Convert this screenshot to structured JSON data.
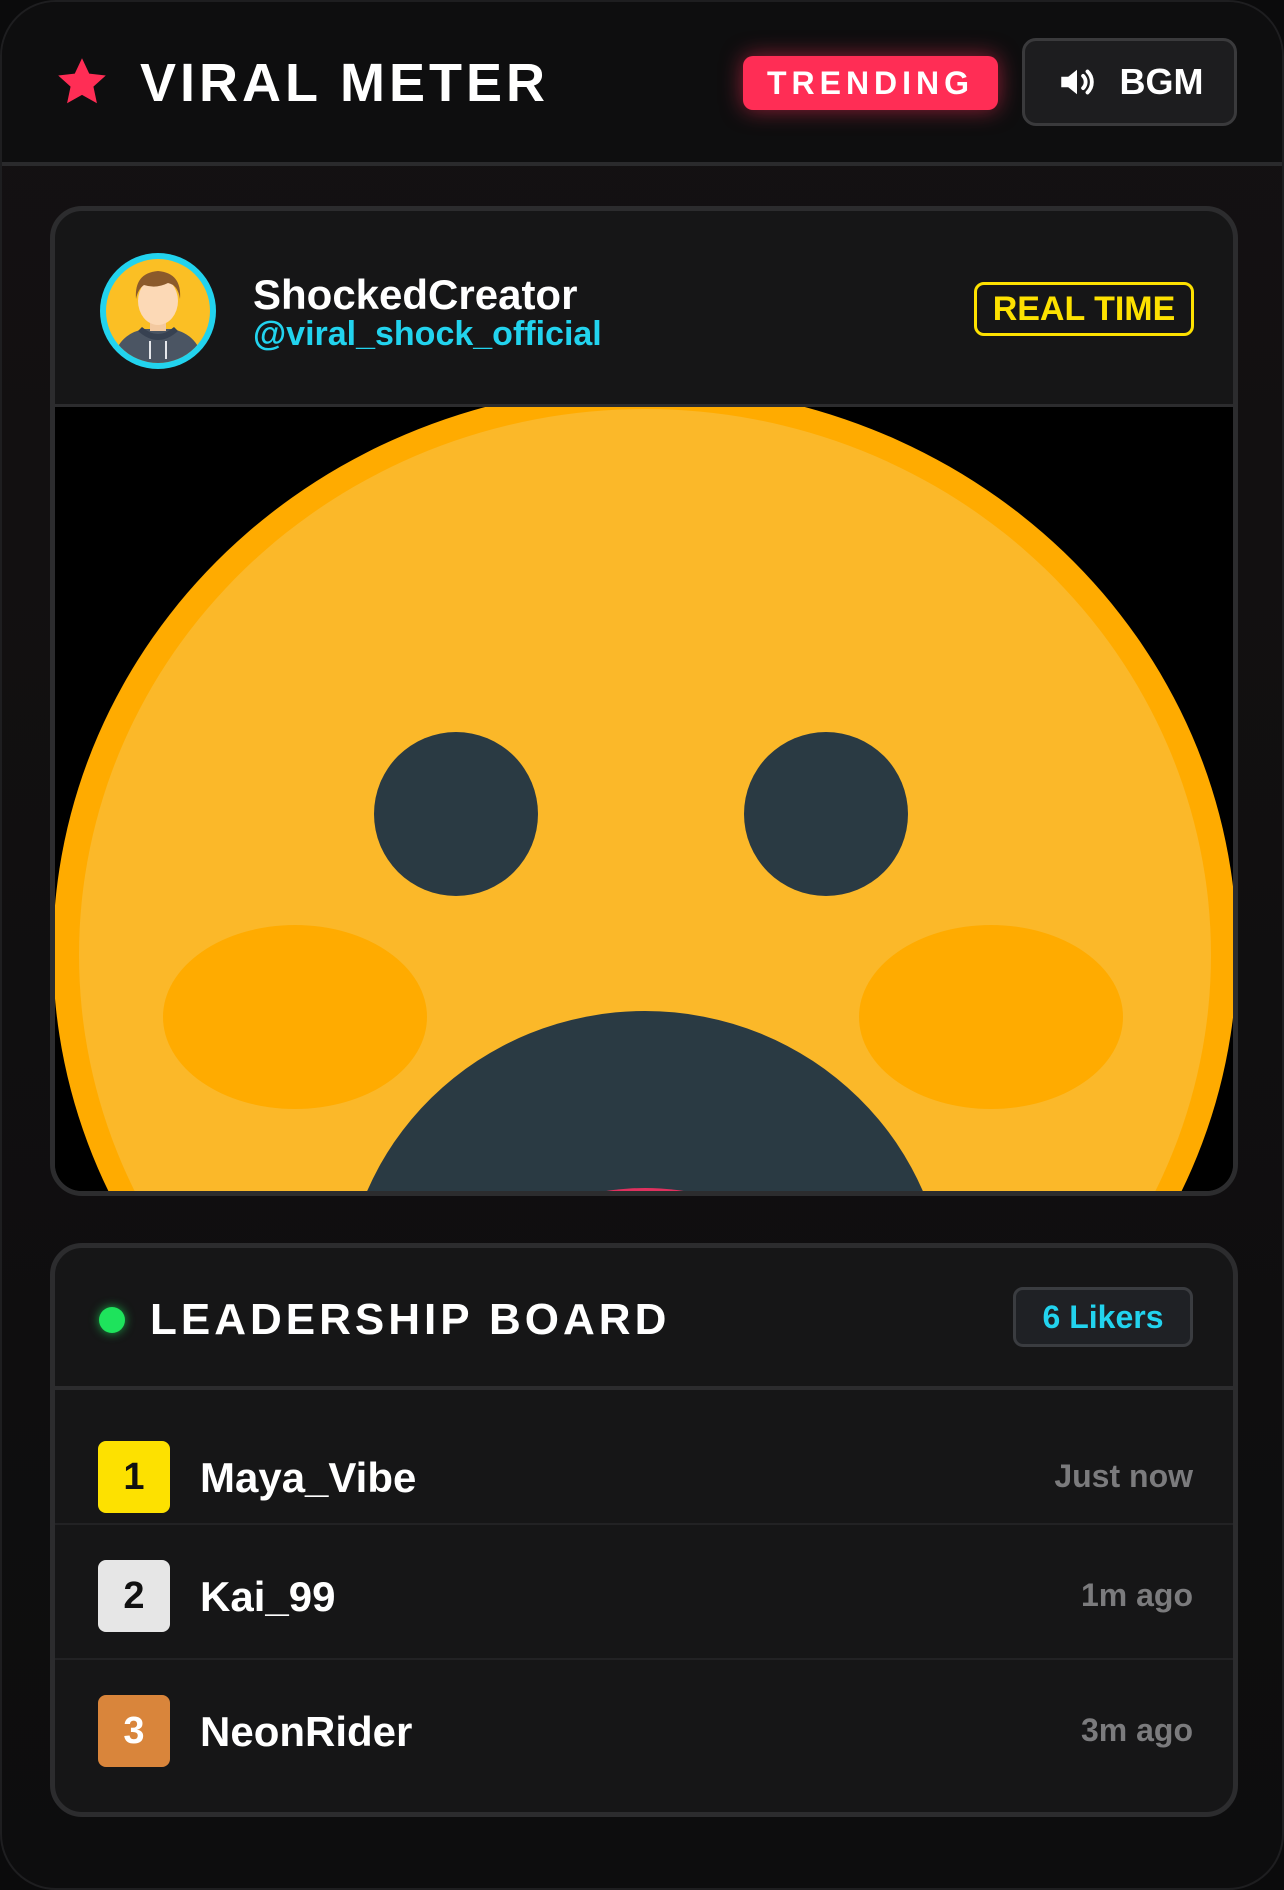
{
  "header": {
    "title": "VIRAL METER",
    "star_icon": "star-icon",
    "trending_label": "TRENDING",
    "bgm_label": "BGM",
    "bgm_icon": "speaker-icon"
  },
  "post": {
    "creator_name": "ShockedCreator",
    "creator_handle": "@viral_shock_official",
    "realtime_label": "REAL TIME",
    "media": "shocked-face-emoji"
  },
  "board": {
    "title": "LEADERSHIP BOARD",
    "likers_count_label": "6 Likers",
    "rows": [
      {
        "rank": "1",
        "name": "Maya_Vibe",
        "time": "Just now"
      },
      {
        "rank": "2",
        "name": "Kai_99",
        "time": "1m ago"
      },
      {
        "rank": "3",
        "name": "NeonRider",
        "time": "3m ago"
      }
    ]
  },
  "colors": {
    "accent_pink": "#ff2d55",
    "accent_cyan": "#22d3ee",
    "accent_yellow": "#fde100",
    "live_green": "#1ee35c",
    "rank_gold": "#fde100",
    "rank_silver": "#e6e6e6",
    "rank_bronze": "#d9853b"
  }
}
